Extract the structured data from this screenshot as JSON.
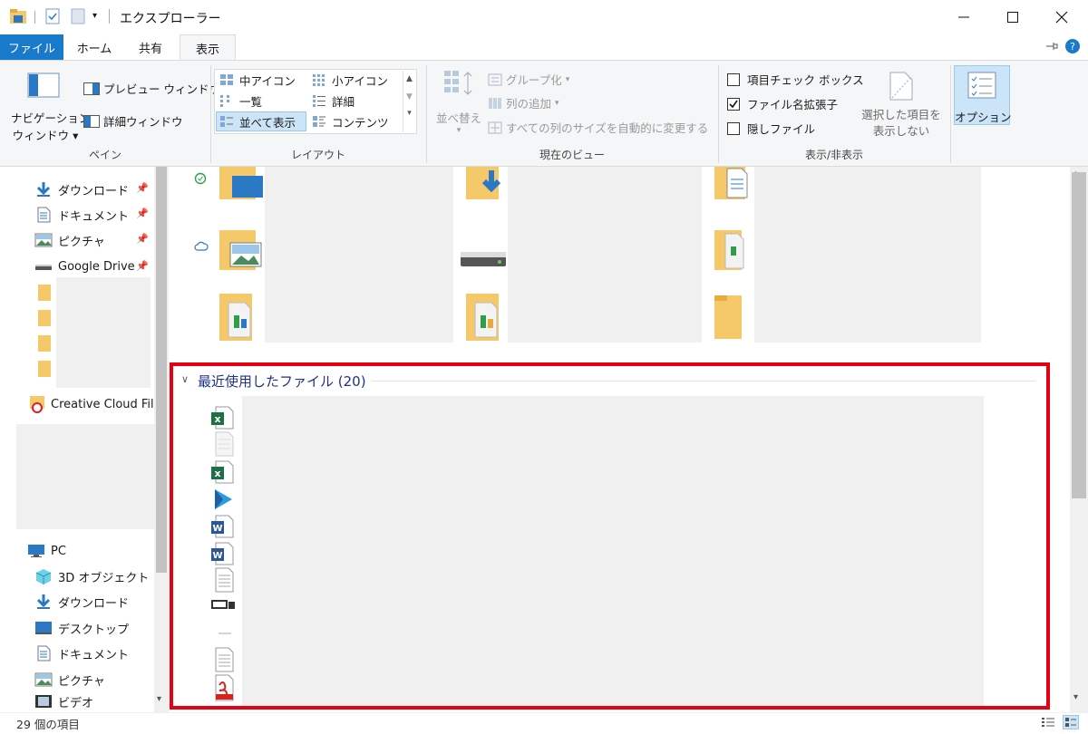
{
  "window": {
    "title": "エクスプローラー"
  },
  "tabs": [
    {
      "label": "ファイル"
    },
    {
      "label": "ホーム"
    },
    {
      "label": "共有"
    },
    {
      "label": "表示"
    }
  ],
  "ribbon": {
    "pane": {
      "nav_pane_line1": "ナビゲーション",
      "nav_pane_line2": "ウィンドウ",
      "preview_pane": "プレビュー ウィンドウ",
      "details_pane": "詳細ウィンドウ",
      "group_label": "ペイン"
    },
    "layout": {
      "items": [
        "中アイコン",
        "小アイコン",
        "一覧",
        "詳細",
        "並べて表示",
        "コンテンツ"
      ],
      "selected": "並べて表示",
      "group_label": "レイアウト"
    },
    "current_view": {
      "sort_by": "並べ替え",
      "group_by": "グループ化",
      "add_columns": "列の追加",
      "size_all_columns": "すべての列のサイズを自動的に変更する",
      "group_label": "現在のビュー"
    },
    "show_hide": {
      "item_checkboxes": "項目チェック ボックス",
      "item_checkboxes_checked": false,
      "file_extensions": "ファイル名拡張子",
      "file_extensions_checked": true,
      "hidden_items": "隠しファイル",
      "hidden_items_checked": false,
      "hide_selected_line1": "選択した項目を",
      "hide_selected_line2": "表示しない",
      "group_label": "表示/非表示"
    },
    "options": {
      "label": "オプション"
    }
  },
  "nav": {
    "quick_access": [
      {
        "label": "ダウンロード",
        "icon": "download-arrow-icon"
      },
      {
        "label": "ドキュメント",
        "icon": "document-icon"
      },
      {
        "label": "ピクチャ",
        "icon": "pictures-icon"
      },
      {
        "label": "Google Drive",
        "icon": "drive-icon"
      }
    ],
    "creative_cloud": "Creative Cloud File",
    "this_pc": {
      "label": "PC",
      "items": [
        {
          "label": "3D オブジェクト",
          "icon": "cube-icon"
        },
        {
          "label": "ダウンロード",
          "icon": "download-arrow-icon"
        },
        {
          "label": "デスクトップ",
          "icon": "desktop-icon"
        },
        {
          "label": "ドキュメント",
          "icon": "document-icon"
        },
        {
          "label": "ピクチャ",
          "icon": "pictures-icon"
        },
        {
          "label": "ビデオ",
          "icon": "video-icon"
        }
      ]
    }
  },
  "content": {
    "recent_files_header": "最近使用したファイル (20)",
    "recent_file_icons": [
      "excel-icon",
      "blank-file-icon",
      "excel-icon",
      "play-app-icon",
      "word-icon",
      "word-icon",
      "text-file-icon",
      "screen-file-icon",
      "dash-icon",
      "text-file-icon",
      "pdf-icon"
    ]
  },
  "status": {
    "item_count": "29 個の項目"
  },
  "colors": {
    "accent": "#1979ca",
    "highlight_box": "#e60012",
    "folder": "#f5c86a",
    "header_text": "#1e3287"
  }
}
